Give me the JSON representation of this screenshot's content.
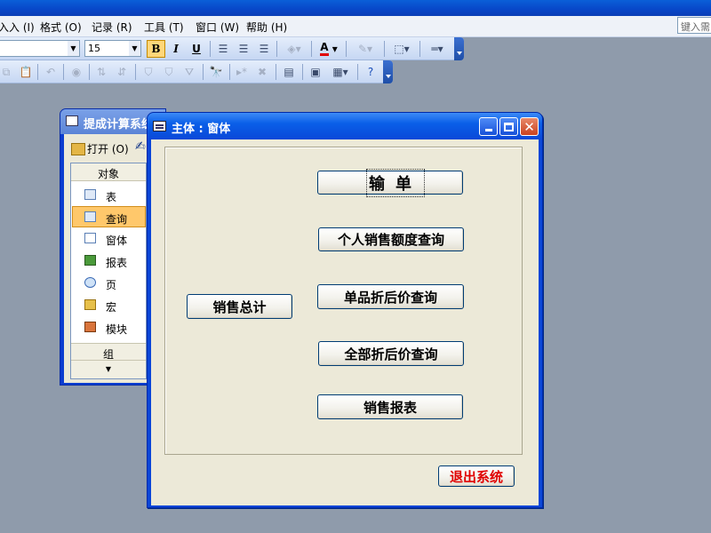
{
  "menubar": {
    "items": [
      "入入 (I)",
      "格式 (O)",
      "记录 (R)",
      "工具 (T)",
      "窗口 (W)",
      "帮助 (H)"
    ],
    "help_search_placeholder": "键入需"
  },
  "toolbar": {
    "font_size": "15",
    "bold_label": "B",
    "italic_label": "I",
    "underline_label": "U",
    "font_color_label": "A"
  },
  "db_window": {
    "title": "提成计算系统",
    "open_label": "打开 (O)",
    "objects_header": "对象",
    "objects": [
      "表",
      "查询",
      "窗体",
      "报表",
      "页",
      "宏",
      "模块"
    ],
    "selected_object": "查询",
    "groups_header": "组"
  },
  "form_window": {
    "title": "主体 : 窗体",
    "buttons": {
      "input": "输单",
      "personal_sales_query": "个人销售额度查询",
      "sales_total": "销售总计",
      "single_discount_query": "单品折后价查询",
      "all_discount_query": "全部折后价查询",
      "sales_report": "销售报表",
      "exit_system": "退出系统"
    }
  },
  "colors": {
    "desktop": "#8f9bab",
    "titlebar": "#0a46d8",
    "window_face": "#ece9d8",
    "selected_item": "#ffc86b",
    "exit_text": "#e00000"
  }
}
